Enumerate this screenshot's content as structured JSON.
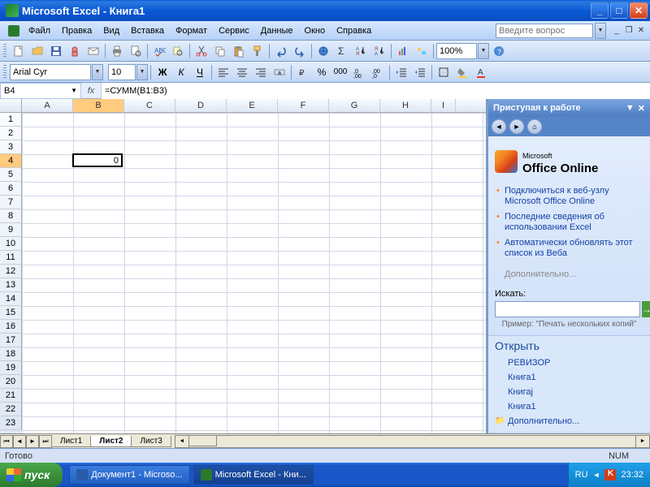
{
  "titlebar": {
    "title": "Microsoft Excel - Книга1"
  },
  "menu": {
    "file": "Файл",
    "edit": "Правка",
    "view": "Вид",
    "insert": "Вставка",
    "format": "Формат",
    "tools": "Сервис",
    "data": "Данные",
    "window": "Окно",
    "help": "Справка"
  },
  "help_placeholder": "Введите вопрос",
  "formatting": {
    "font": "Arial Cyr",
    "size": "10",
    "zoom": "100%"
  },
  "formula": {
    "cell_ref": "B4",
    "fx": "fx",
    "value": "=СУММ(B1:B3)"
  },
  "columns": [
    "A",
    "B",
    "C",
    "D",
    "E",
    "F",
    "G",
    "H",
    "I"
  ],
  "rows": [
    "1",
    "2",
    "3",
    "4",
    "5",
    "6",
    "7",
    "8",
    "9",
    "10",
    "11",
    "12",
    "13",
    "14",
    "15",
    "16",
    "17",
    "18",
    "19",
    "20",
    "21",
    "22",
    "23"
  ],
  "active_cell": {
    "row": 4,
    "col": "B",
    "display": "0"
  },
  "taskpane": {
    "title": "Приступая к работе",
    "office_online": "Office Online",
    "office_prefix": "Microsoft",
    "links": [
      "Подключиться к веб-узлу Microsoft Office Online",
      "Последние сведения об использовании Excel",
      "Автоматически обновлять этот список из Веба"
    ],
    "more": "Дополнительно...",
    "search_label": "Искать:",
    "example": "Пример: \"Печать нескольких копий\"",
    "open_header": "Открыть",
    "recent": [
      "РЕВИЗОР",
      "Книга1",
      "Книгаj",
      "Книга1"
    ],
    "open_more": "Дополнительно..."
  },
  "sheets": {
    "s1": "Лист1",
    "s2": "Лист2",
    "s3": "Лист3"
  },
  "status": {
    "ready": "Готово",
    "num": "NUM"
  },
  "taskbar": {
    "start": "пуск",
    "word": "Документ1 - Microso...",
    "excel": "Microsoft Excel - Кни...",
    "lang": "RU",
    "time": "23:32"
  }
}
